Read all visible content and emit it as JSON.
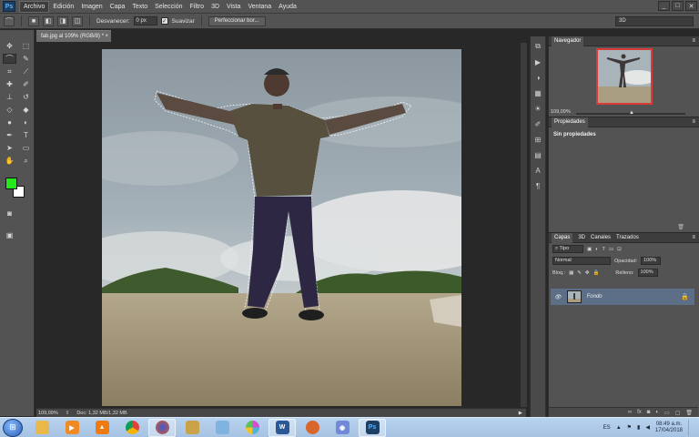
{
  "app": {
    "logo": "Ps"
  },
  "menu": [
    "Archivo",
    "Edición",
    "Imagen",
    "Capa",
    "Texto",
    "Selección",
    "Filtro",
    "3D",
    "Vista",
    "Ventana",
    "Ayuda"
  ],
  "window_controls": {
    "minimize": "_",
    "maximize": "□",
    "close": "✕"
  },
  "options": {
    "feather_label": "Desvanecer:",
    "feather_value": "0 px",
    "antialias_label": "Suavizar",
    "refine_button": "Perfeccionar bor...",
    "workspace": "3D"
  },
  "tools": [
    "move-icon",
    "marquee-icon",
    "lasso-icon",
    "quick-select-icon",
    "crop-icon",
    "eyedropper-icon",
    "healing-icon",
    "brush-icon",
    "stamp-icon",
    "history-brush-icon",
    "eraser-icon",
    "gradient-icon",
    "blur-icon",
    "dodge-icon",
    "pen-icon",
    "type-icon",
    "path-select-icon",
    "shape-icon",
    "hand-icon",
    "zoom-icon"
  ],
  "colors": {
    "foreground": "#22e81c",
    "background": "#ffffff"
  },
  "document": {
    "tab_title": "fab.jpg al 109% (RGB/8) *",
    "tab_close": "×",
    "zoom": "109,09%",
    "doc_info": "Doc: 1,32 MB/1,32 MB"
  },
  "navigator": {
    "title": "Navegador",
    "zoom": "109,09%"
  },
  "properties": {
    "title": "Propiedades",
    "content": "Sin propiedades"
  },
  "layers": {
    "tabs": [
      "Capas",
      "3D",
      "Canales",
      "Trazados"
    ],
    "filter_label": "Tipo",
    "blend_mode": "Normal",
    "opacity_label": "Opacidad:",
    "opacity_value": "100%",
    "lock_label": "Bloq.:",
    "fill_label": "Relleno:",
    "fill_value": "100%",
    "layer_name": "Fondo"
  },
  "taskbar": {
    "apps": [
      {
        "name": "explorer",
        "label": "",
        "color": "#e8b84a"
      },
      {
        "name": "media",
        "label": "▶",
        "color": "#f08a24"
      },
      {
        "name": "vlc",
        "label": "▲",
        "color": "#f07a10"
      },
      {
        "name": "chrome",
        "label": "",
        "color": "#2ea44f"
      },
      {
        "name": "firefox",
        "label": "",
        "color": "#e0541c"
      },
      {
        "name": "archive",
        "label": "",
        "color": "#c9a24a"
      },
      {
        "name": "paint",
        "label": "",
        "color": "#7fb3e0"
      },
      {
        "name": "picasa",
        "label": "",
        "color": "#d24fd0"
      },
      {
        "name": "word",
        "label": "W",
        "color": "#2b5797"
      },
      {
        "name": "game",
        "label": "",
        "color": "#d9662b"
      },
      {
        "name": "discord",
        "label": "◉",
        "color": "#7289da"
      },
      {
        "name": "photoshop",
        "label": "Ps",
        "color": "#1c3f63"
      }
    ],
    "language": "ES",
    "time": "08:49 a.m.",
    "date": "17/04/2018"
  }
}
